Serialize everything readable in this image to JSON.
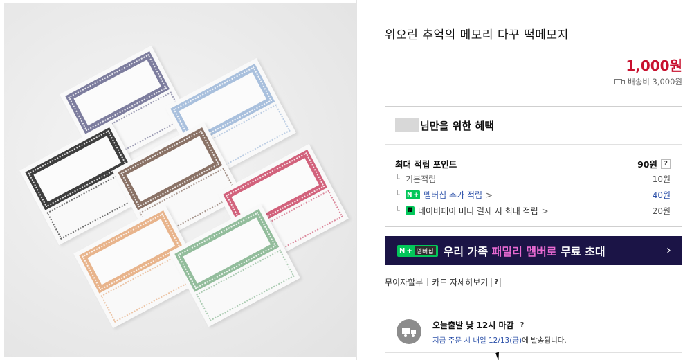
{
  "product": {
    "title": "위오린 추억의 메모리 다꾸 떡메모지",
    "price": "1,000원",
    "shipping_fee": "배송비 3,000원",
    "memo_colors": [
      "#7d7d9e",
      "#a9c0dd",
      "#3e3e3e",
      "#8a7266",
      "#d2627c",
      "#e8b48c",
      "#93bd9c"
    ]
  },
  "benefits": {
    "header": "님만을 위한 혜택",
    "max_points_label": "최대 적립 포인트",
    "max_points_value": "90원",
    "help": "?",
    "rows": [
      {
        "label": "기본적립",
        "value": "10원"
      },
      {
        "label": "멤버십 추가 적립",
        "value": "40원"
      },
      {
        "label": "네이버페이 머니 결제 시 최대 적립",
        "value": "20원"
      }
    ],
    "chevron": ">"
  },
  "banner": {
    "badge_n": "N",
    "badge_plus": "+",
    "badge_text": "멤버십",
    "text_part1": "우리 가족",
    "text_highlight": "패밀리 멤버로",
    "text_part2": "무료 초대",
    "arrow": "›",
    "bg_color": "#1b1446",
    "highlight_color": "#e86ad2"
  },
  "payment": {
    "installment": "무이자할부",
    "card_details": "카드 자세히보기",
    "help": "?"
  },
  "delivery": {
    "title": "오늘출발 낮 12시 마감",
    "help": "?",
    "desc_highlight": "지금 주문 시 내일 12/13(금)",
    "desc_tail": "에 발송됩니다."
  }
}
